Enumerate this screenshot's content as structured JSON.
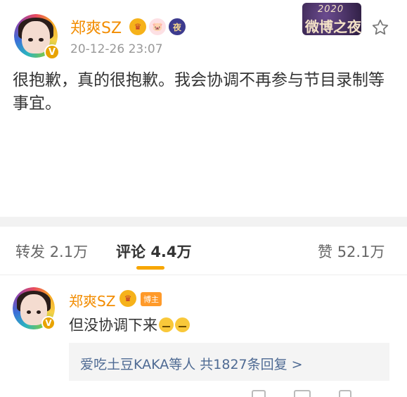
{
  "post": {
    "username": "郑爽SZ",
    "badges": [
      "crown-badge-icon",
      "pig-badge-icon",
      "night-badge-icon"
    ],
    "night_badge_label": "夜",
    "verified_mark": "V",
    "timestamp": "20-12-26 23:07",
    "text": "很抱歉，真的很抱歉。我会协调不再参与节目录制等事宜。",
    "event_banner": {
      "year": "2020",
      "title": "微博之夜"
    }
  },
  "tabs": [
    {
      "label": "转发",
      "count": "2.1万"
    },
    {
      "label": "评论",
      "count": "4.4万",
      "active": true
    },
    {
      "label": "赞",
      "count": "52.1万"
    }
  ],
  "comment": {
    "username": "郑爽SZ",
    "author_tag": "博主",
    "verified_mark": "V",
    "text": "但没协调下来",
    "replies_link": "爱吃土豆KAKA等人 共1827条回复 >"
  },
  "colors": {
    "accent": "#f28c00",
    "link": "#4e6a93",
    "tab_underline": "#f7a600"
  }
}
